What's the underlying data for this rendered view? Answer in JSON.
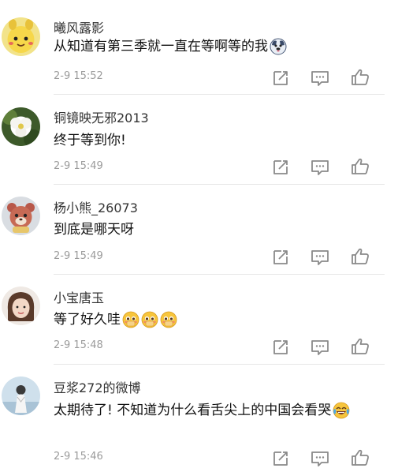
{
  "comments": [
    {
      "username": "曦风露影",
      "text": "从知道有第三季就一直在等啊等的我",
      "emojis": [
        "dog-face-emoji"
      ],
      "time": "2-9 15:52"
    },
    {
      "username": "铜镜映无邪2013",
      "text": "终于等到你!",
      "emojis": [],
      "time": "2-9 15:49"
    },
    {
      "username": "杨小熊_26073",
      "text": "到底是哪天呀",
      "emojis": [],
      "time": "2-9 15:49"
    },
    {
      "username": "小宝唐玉",
      "text": "等了好久哇",
      "emojis": [
        "pleading-face-emoji",
        "pleading-face-emoji",
        "pleading-face-emoji"
      ],
      "time": "2-9 15:48"
    },
    {
      "username": "豆浆272的微博",
      "text": "太期待了! 不知道为什么看舌尖上的中国会看哭",
      "emojis": [
        "crying-laughing-emoji"
      ],
      "time": "2-9 15:46"
    }
  ],
  "icons": {
    "share": "share-icon",
    "reply": "comment-reply-icon",
    "like": "thumbs-up-icon"
  },
  "colors": {
    "username": "#333333",
    "text": "#111111",
    "time": "#9b9b9b",
    "icon": "#8a8a8a",
    "divider": "#e6e6e6"
  }
}
